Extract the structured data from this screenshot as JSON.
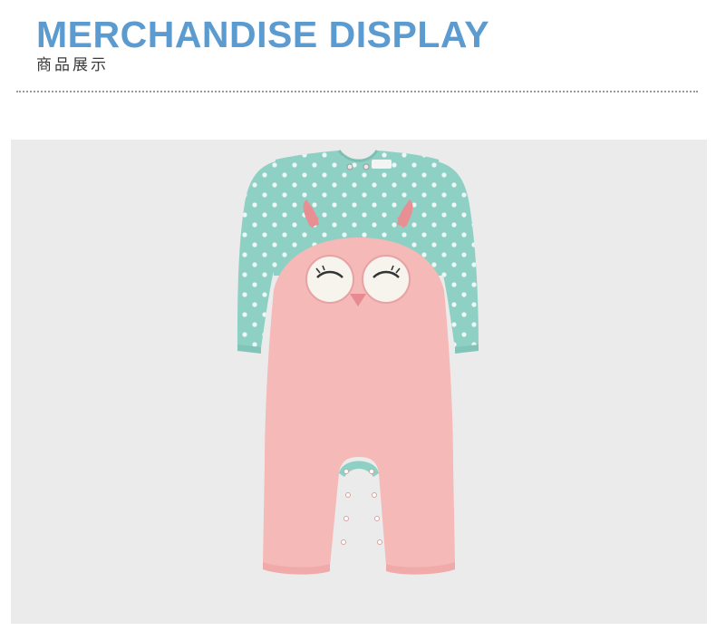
{
  "header": {
    "title_en": "MERCHANDISE DISPLAY",
    "title_cn": "商品展示"
  },
  "product": {
    "image_icon": "baby-owl-jumpsuit-photo",
    "colors": {
      "mint": "#8fd0c4",
      "pink": "#f5b9b8",
      "background": "#ebebeb",
      "accent_blue": "#5b9bd0"
    }
  }
}
